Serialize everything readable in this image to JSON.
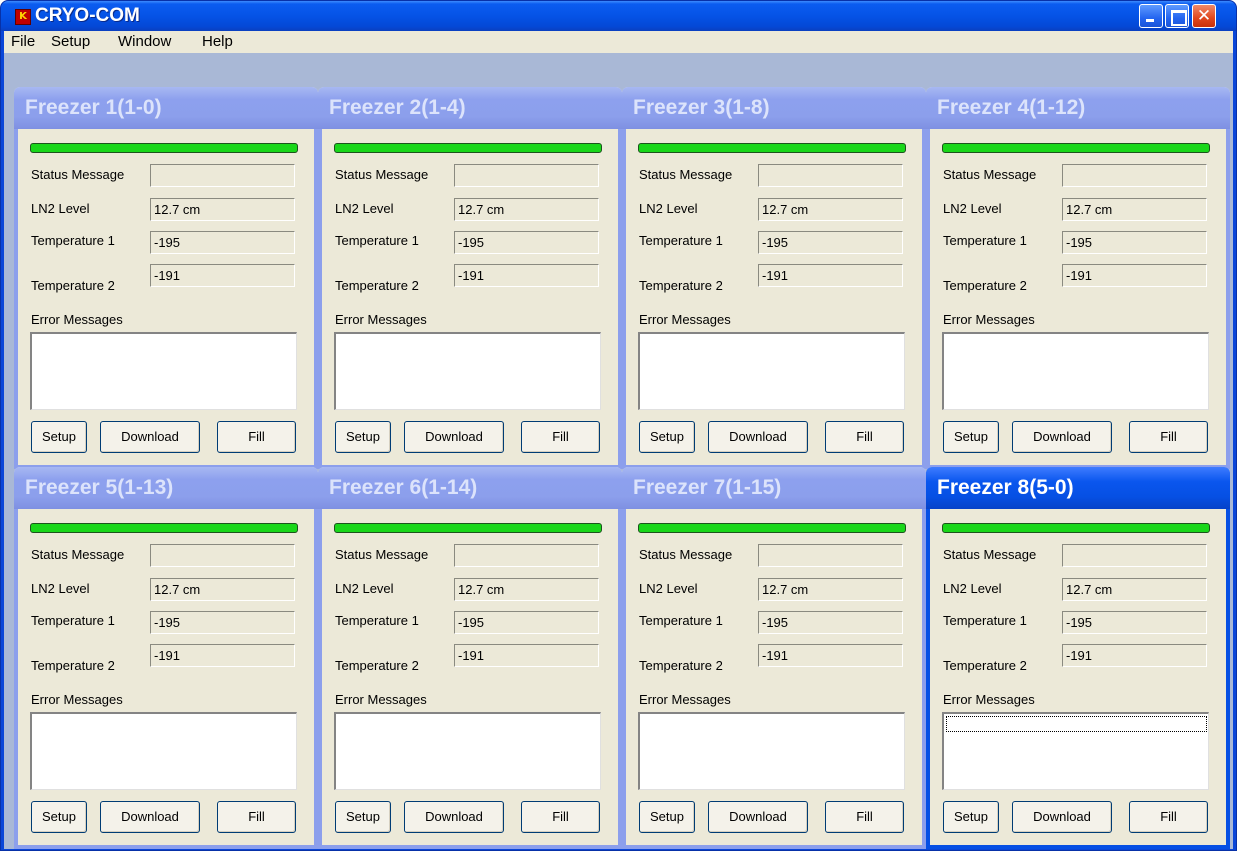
{
  "window": {
    "title": "CRYO-COM",
    "icon": "app-logo-icon"
  },
  "menu": [
    {
      "label": "File"
    },
    {
      "label": "Setup"
    },
    {
      "label": "Window"
    },
    {
      "label": "Help"
    }
  ],
  "labels": {
    "status": "Status Message",
    "ln2": "LN2 Level",
    "temp1": "Temperature 1",
    "temp2": "Temperature 2",
    "errors": "Error Messages",
    "setup": "Setup",
    "download": "Download",
    "fill": "Fill"
  },
  "freezers": [
    {
      "title": "Freezer 1(1-0)",
      "status": "",
      "ln2": "12.7 cm",
      "temp1": "-195",
      "temp2": "-191",
      "errors": "",
      "active": false
    },
    {
      "title": "Freezer 2(1-4)",
      "status": "",
      "ln2": "12.7 cm",
      "temp1": "-195",
      "temp2": "-191",
      "errors": "",
      "active": false
    },
    {
      "title": "Freezer 3(1-8)",
      "status": "",
      "ln2": "12.7 cm",
      "temp1": "-195",
      "temp2": "-191",
      "errors": "",
      "active": false
    },
    {
      "title": "Freezer 4(1-12)",
      "status": "",
      "ln2": "12.7 cm",
      "temp1": "-195",
      "temp2": "-191",
      "errors": "",
      "active": false
    },
    {
      "title": "Freezer 5(1-13)",
      "status": "",
      "ln2": "12.7 cm",
      "temp1": "-195",
      "temp2": "-191",
      "errors": "",
      "active": false
    },
    {
      "title": "Freezer 6(1-14)",
      "status": "",
      "ln2": "12.7 cm",
      "temp1": "-195",
      "temp2": "-191",
      "errors": "",
      "active": false
    },
    {
      "title": "Freezer 7(1-15)",
      "status": "",
      "ln2": "12.7 cm",
      "temp1": "-195",
      "temp2": "-191",
      "errors": "",
      "active": false
    },
    {
      "title": "Freezer 8(5-0)",
      "status": "",
      "ln2": "12.7 cm",
      "temp1": "-195",
      "temp2": "-191",
      "errors": "",
      "active": true
    }
  ],
  "colors": {
    "level_bar": "#19d719",
    "active_panel": "#0650e4",
    "inactive_panel": "#8c9fec"
  }
}
